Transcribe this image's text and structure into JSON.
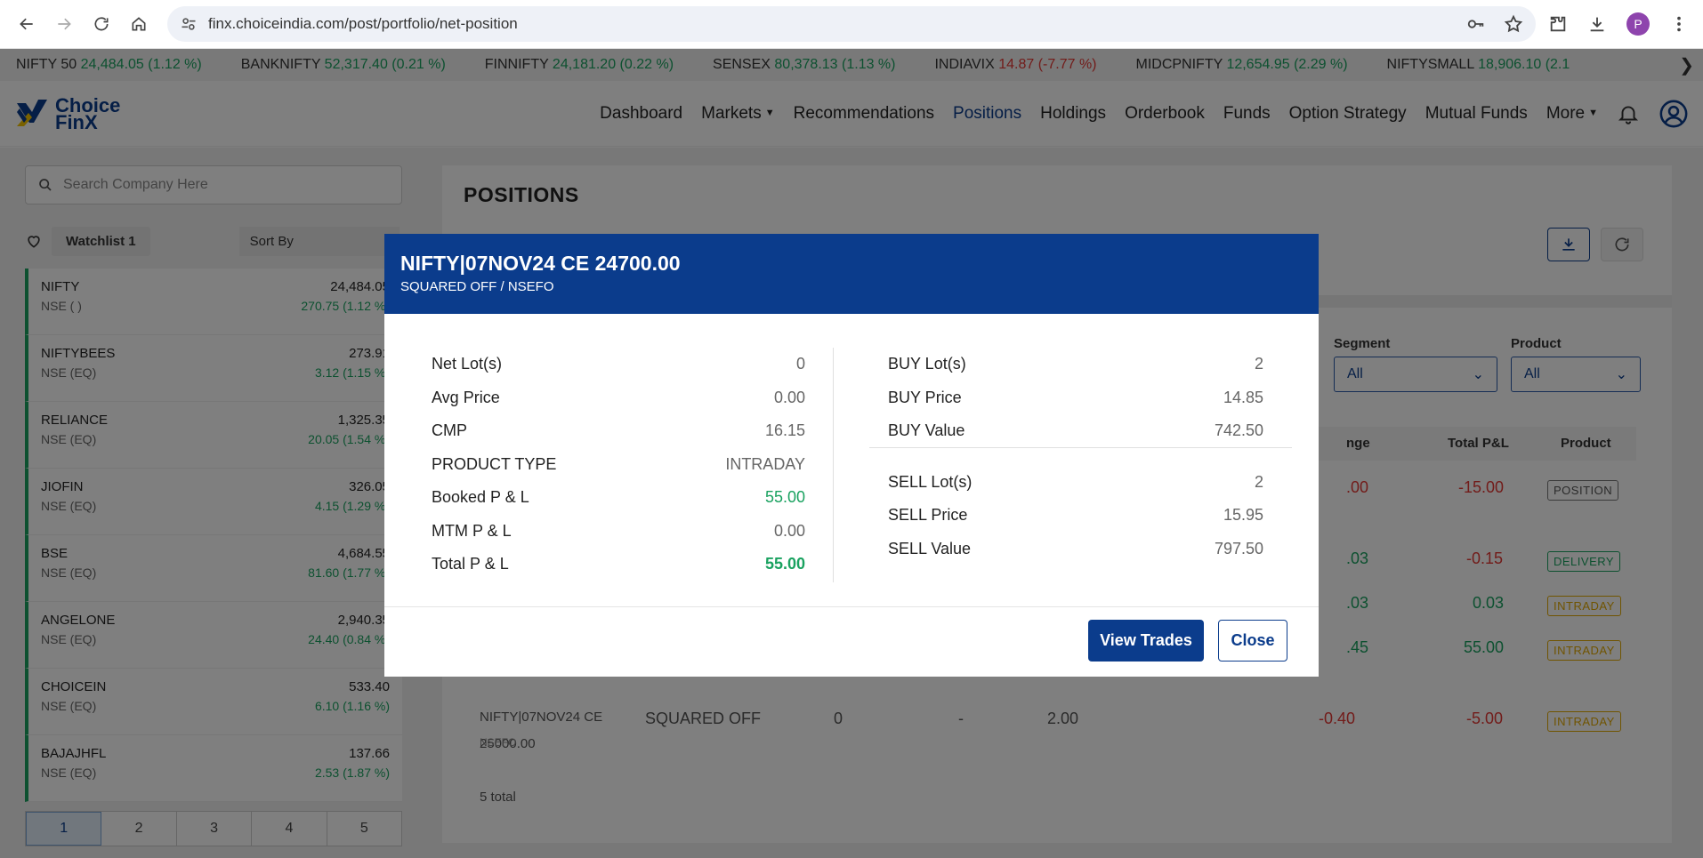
{
  "browser": {
    "url": "finx.choiceindia.com/post/portfolio/net-position",
    "profile_initial": "P"
  },
  "ticker": [
    {
      "name": "NIFTY 50",
      "value": "24,484.05 (1.12 %)",
      "dir": "up"
    },
    {
      "name": "BANKNIFTY",
      "value": "52,317.40 (0.21 %)",
      "dir": "up"
    },
    {
      "name": "FINNIFTY",
      "value": "24,181.20 (0.22 %)",
      "dir": "up"
    },
    {
      "name": "SENSEX",
      "value": "80,378.13 (1.13 %)",
      "dir": "up"
    },
    {
      "name": "INDIAVIX",
      "value": "14.87 (-7.77 %)",
      "dir": "down"
    },
    {
      "name": "MIDCPNIFTY",
      "value": "12,654.95 (2.29 %)",
      "dir": "up"
    },
    {
      "name": "NIFTYSMALL",
      "value": "18,906.10 (2.1",
      "dir": "up"
    }
  ],
  "app": {
    "logo_line1": "Choice",
    "logo_line2": "FinX",
    "menu": [
      "Dashboard",
      "Markets",
      "Recommendations",
      "Positions",
      "Holdings",
      "Orderbook",
      "Funds",
      "Option Strategy",
      "Mutual Funds",
      "More"
    ]
  },
  "sidebar": {
    "search_placeholder": "Search Company Here",
    "watchlist_tab": "Watchlist 1",
    "sort_label": "Sort By",
    "items": [
      {
        "name": "NIFTY",
        "exchange": "NSE ( )",
        "price": "24,484.05",
        "change": "270.75 (1.12 %)"
      },
      {
        "name": "NIFTYBEES",
        "exchange": "NSE (EQ)",
        "price": "273.91",
        "change": "3.12 (1.15 %)"
      },
      {
        "name": "RELIANCE",
        "exchange": "NSE (EQ)",
        "price": "1,325.35",
        "change": "20.05 (1.54 %)"
      },
      {
        "name": "JIOFIN",
        "exchange": "NSE (EQ)",
        "price": "326.05",
        "change": "4.15 (1.29 %)"
      },
      {
        "name": "BSE",
        "exchange": "NSE (EQ)",
        "price": "4,684.55",
        "change": "81.60 (1.77 %)"
      },
      {
        "name": "ANGELONE",
        "exchange": "NSE (EQ)",
        "price": "2,940.35",
        "change": "24.40 (0.84 %)"
      },
      {
        "name": "CHOICEIN",
        "exchange": "NSE (EQ)",
        "price": "533.40",
        "change": "6.10 (1.16 %)"
      },
      {
        "name": "BAJAJHFL",
        "exchange": "NSE (EQ)",
        "price": "137.66",
        "change": "2.53 (1.87 %)"
      }
    ],
    "pages": [
      "1",
      "2",
      "3",
      "4",
      "5"
    ]
  },
  "main": {
    "title": "POSITIONS",
    "filters": {
      "segment_label": "Segment",
      "segment_value": "All",
      "product_label": "Product",
      "product_value": "All"
    },
    "columns": {
      "change": "nge",
      "total_pl": "Total P&L",
      "product": "Product"
    },
    "rows": [
      {
        "change": ".00",
        "total": "-15.00",
        "product": "POSITION"
      },
      {
        "change": ".03",
        "total": "-0.15",
        "product": "DELIVERY"
      },
      {
        "change": ".03",
        "total": "0.03",
        "product": "INTRADAY"
      },
      {
        "change": ".45",
        "total": "55.00",
        "product": "INTRADAY"
      }
    ],
    "last_row": {
      "symbol_line1": "NIFTY|07NOV24 CE",
      "symbol_line2": "25000.00",
      "exchange": "NSEFO",
      "status": "SQUARED OFF",
      "net": "0",
      "avg": "-",
      "ltp": "2.00",
      "change": "-0.40",
      "total": "-5.00",
      "product": "INTRADAY"
    },
    "total_label": "5 total"
  },
  "modal": {
    "title": "NIFTY|07NOV24 CE 24700.00",
    "subtitle": "SQUARED OFF / NSEFO",
    "left": [
      {
        "k": "Net Lot(s)",
        "v": "0"
      },
      {
        "k": "Avg Price",
        "v": "0.00"
      },
      {
        "k": "CMP",
        "v": "16.15"
      },
      {
        "k": "PRODUCT TYPE",
        "v": "INTRADAY"
      },
      {
        "k": "Booked P & L",
        "v": "55.00"
      },
      {
        "k": "MTM P & L",
        "v": "0.00"
      },
      {
        "k": "Total P & L",
        "v": "55.00"
      }
    ],
    "buy": [
      {
        "k": "BUY Lot(s)",
        "v": "2"
      },
      {
        "k": "BUY Price",
        "v": "14.85"
      },
      {
        "k": "BUY Value",
        "v": "742.50"
      }
    ],
    "sell": [
      {
        "k": "SELL Lot(s)",
        "v": "2"
      },
      {
        "k": "SELL Price",
        "v": "15.95"
      },
      {
        "k": "SELL Value",
        "v": "797.50"
      }
    ],
    "view_trades_label": "View Trades",
    "close_label": "Close"
  }
}
